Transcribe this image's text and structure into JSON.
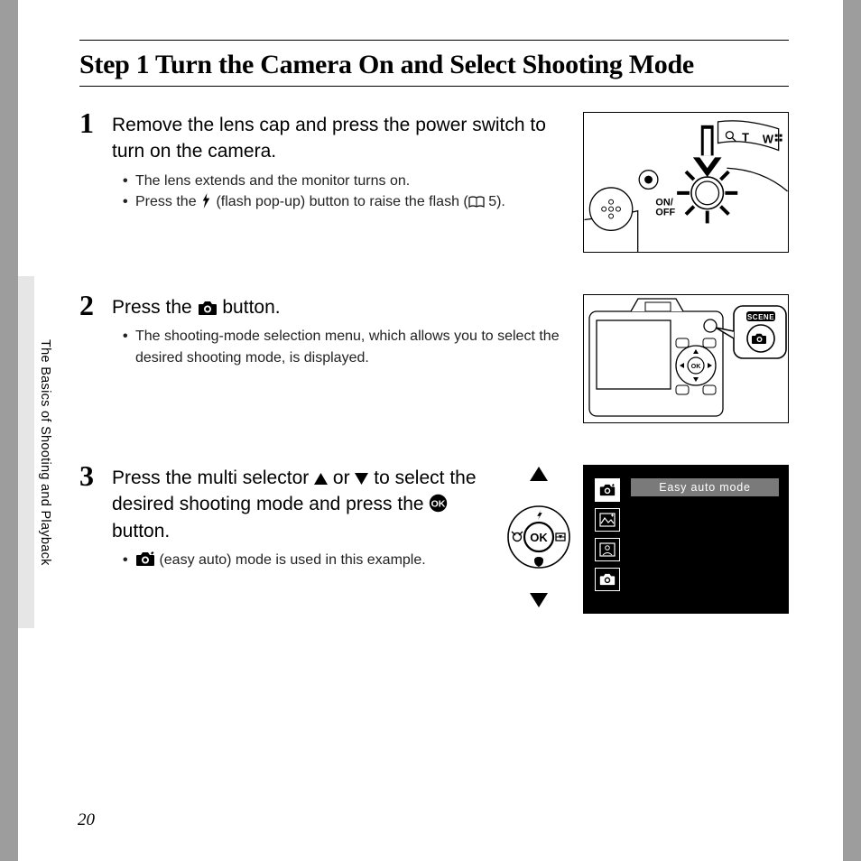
{
  "title": "Step 1 Turn the Camera On and Select Shooting Mode",
  "side_label": "The Basics of Shooting and Playback",
  "page_number": "20",
  "steps": [
    {
      "num": "1",
      "lead": "Remove the lens cap and press the power switch to turn on the camera.",
      "bullets": [
        "The lens extends and the monitor turns on.",
        "Press the {flash} (flash pop-up) button to raise the flash ({book} 5)."
      ]
    },
    {
      "num": "2",
      "lead": "Press the {camera} button.",
      "bullets": [
        "The shooting-mode selection menu, which allows you to select the desired shooting mode, is displayed."
      ]
    },
    {
      "num": "3",
      "lead": "Press the multi selector {up} or {down} to select the desired shooting mode and press the {ok} button.",
      "bullets": [
        "{easy} (easy auto) mode is used in this example."
      ]
    }
  ],
  "lcd": {
    "mode_label": "Easy auto mode"
  },
  "illus1_labels": {
    "on_off": "ON/\nOFF",
    "t": "T",
    "w": "W"
  },
  "illus2_label": "SCENE",
  "multi_selector_label": "OK"
}
